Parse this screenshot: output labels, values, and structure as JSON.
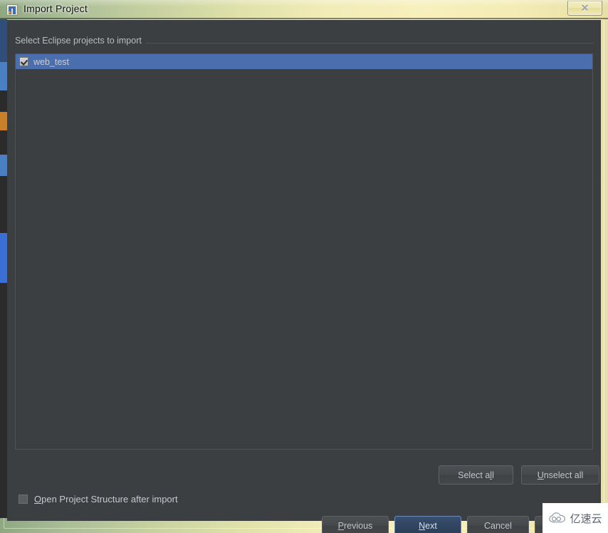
{
  "window": {
    "title": "Import Project",
    "icon": "intellij-idea-icon",
    "close_label": "✕"
  },
  "group": {
    "label": "Select Eclipse projects to import"
  },
  "project_list": {
    "items": [
      {
        "label": "web_test",
        "checked": true,
        "selected": true
      }
    ]
  },
  "list_actions": {
    "select_all": {
      "pre": "Select a",
      "mnemonic": "l",
      "post": "l"
    },
    "unselect_all": {
      "pre": "",
      "mnemonic": "U",
      "post": "nselect all"
    }
  },
  "options": {
    "open_project_structure": {
      "pre": "",
      "mnemonic": "O",
      "post": "pen Project Structure after import",
      "checked": false
    }
  },
  "actions": {
    "previous": {
      "pre": "",
      "mnemonic": "P",
      "post": "revious"
    },
    "next": {
      "pre": "",
      "mnemonic": "N",
      "post": "ext"
    },
    "cancel": {
      "pre": "Cancel",
      "mnemonic": "",
      "post": ""
    },
    "help": {
      "pre": "",
      "mnemonic": "",
      "post": ""
    }
  },
  "watermark": {
    "text": "亿速云",
    "icon": "cloud-icon"
  },
  "colors": {
    "dialog_bg": "#3c3f41",
    "selection_blue": "#4b6eaf",
    "default_button_blue": "#31476a",
    "text": "#bbbbbb",
    "frame_glass": "#e6dfa6"
  }
}
